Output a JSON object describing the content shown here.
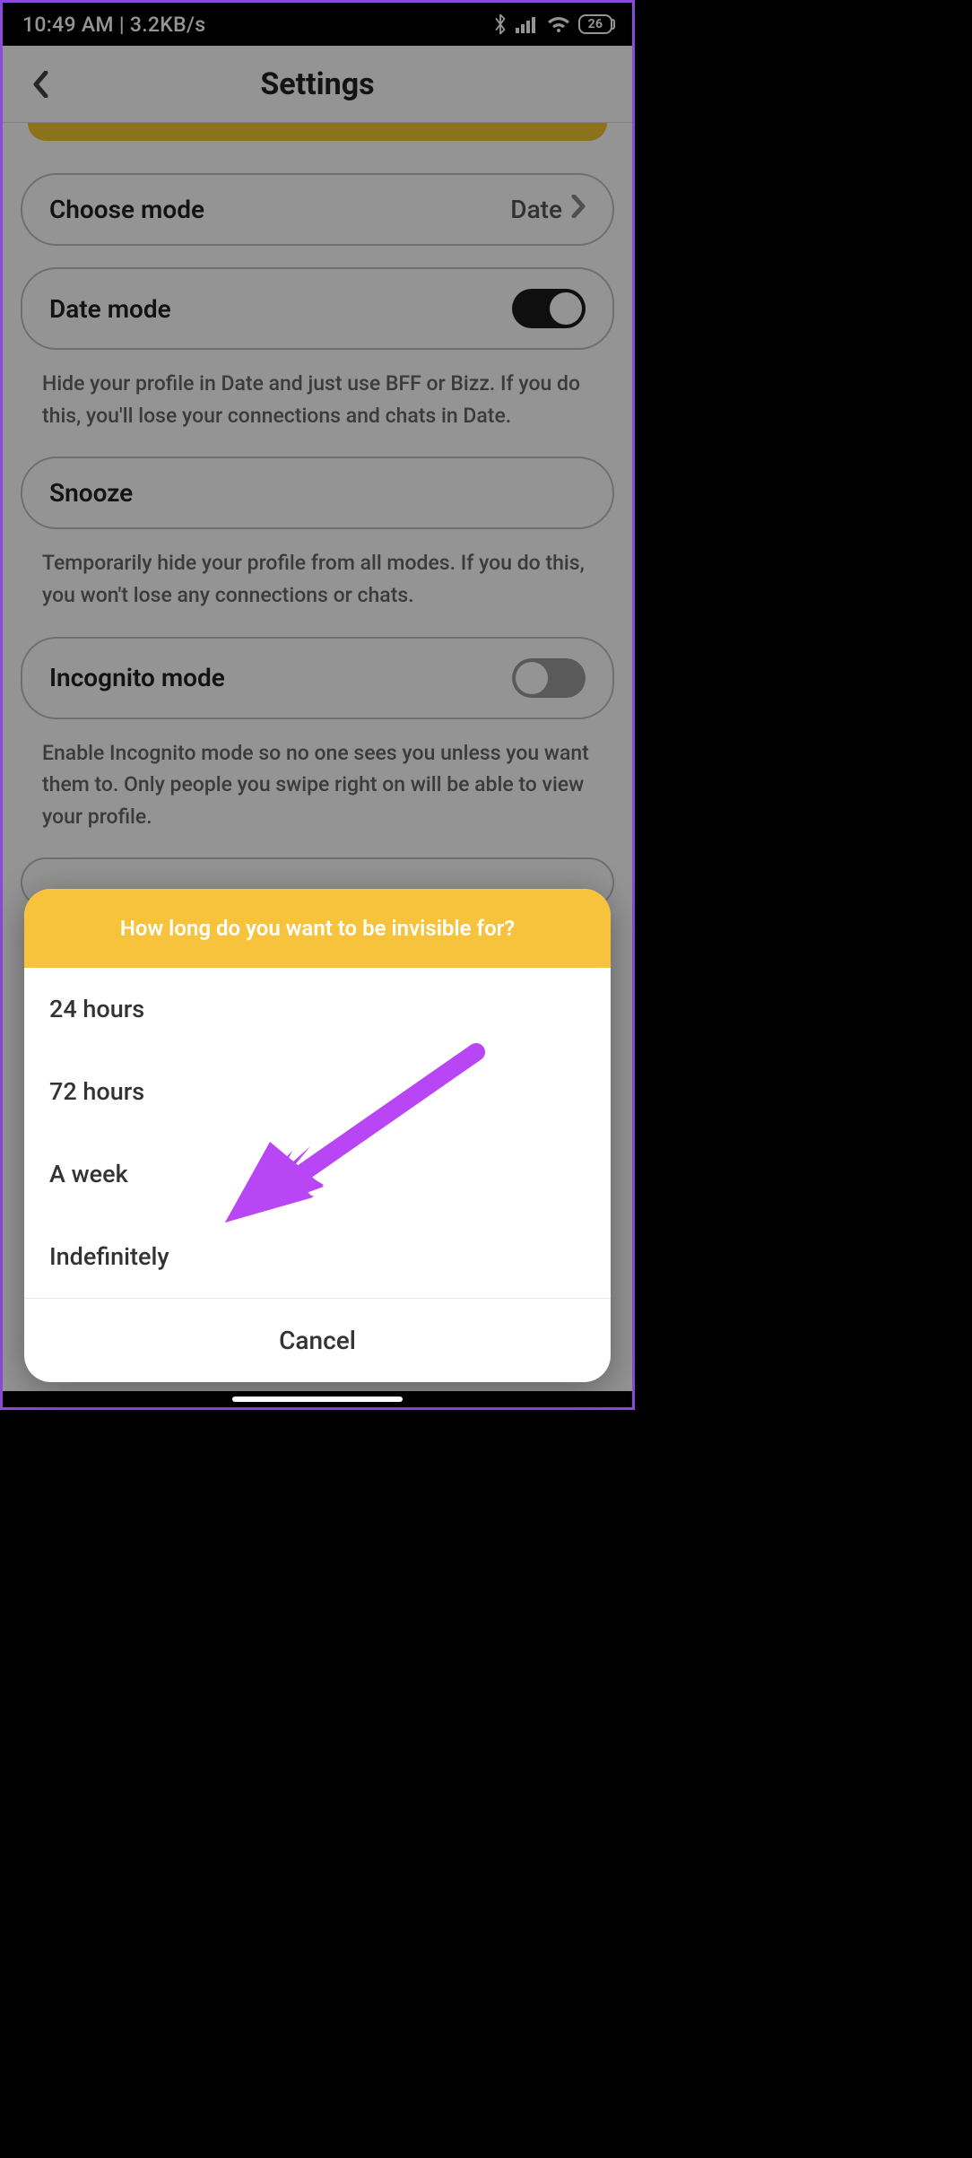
{
  "status": {
    "time": "10:49 AM",
    "sep": "|",
    "rate": "3.2KB/s",
    "battery": "26"
  },
  "header": {
    "title": "Settings"
  },
  "rows": {
    "choose_mode": {
      "label": "Choose mode",
      "value": "Date"
    },
    "date_mode": {
      "label": "Date mode",
      "desc": "Hide your profile in Date and just use BFF or Bizz. If you do this, you'll lose your connections and chats in Date."
    },
    "snooze": {
      "label": "Snooze",
      "desc": "Temporarily hide your profile from all modes. If you do this, you won't lose any connections or chats."
    },
    "incognito": {
      "label": "Incognito mode",
      "desc": "Enable Incognito mode so no one sees you unless you want them to. Only people you swipe right on will be able to view your profile."
    }
  },
  "sheet": {
    "title": "How long do you want to be invisible for?",
    "options": [
      "24 hours",
      "72 hours",
      "A week",
      "Indefinitely"
    ],
    "cancel": "Cancel"
  },
  "colors": {
    "accent": "#f7c23c",
    "pointer": "#b946f5"
  }
}
